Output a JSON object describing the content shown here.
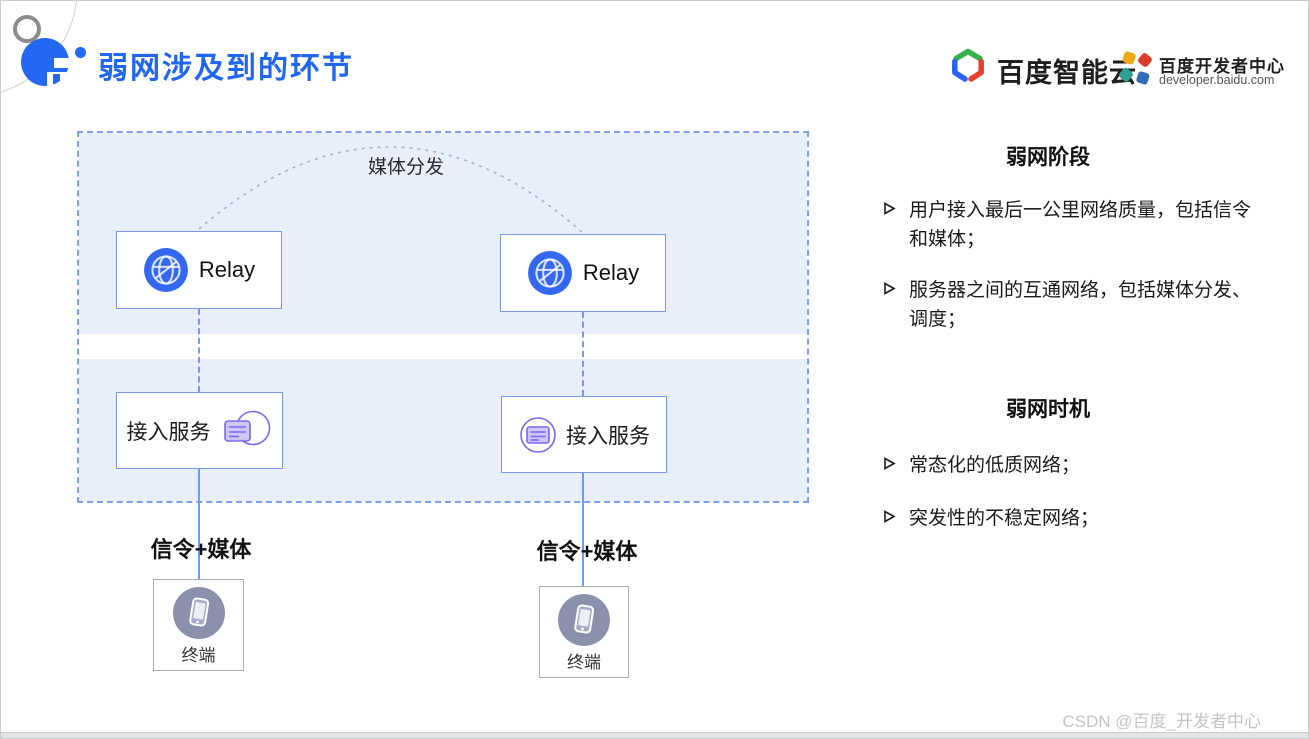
{
  "header": {
    "title": "弱网涉及到的环节",
    "brand_cloud": "百度智能云",
    "brand_dev_name": "百度开发者中心",
    "brand_dev_url": "developer.baidu.com"
  },
  "diagram": {
    "arc_label": "媒体分发",
    "relay_left": "Relay",
    "relay_right": "Relay",
    "access_left": "接入服务",
    "access_right": "接入服务",
    "link_left": "信令+媒体",
    "link_right": "信令+媒体",
    "terminal_left": "终端",
    "terminal_right": "终端"
  },
  "panel": {
    "section1": {
      "title": "弱网阶段",
      "bullets": [
        "用户接入最后一公里网络质量，包括信令和媒体；",
        "服务器之间的互通网络，包括媒体分发、调度；"
      ]
    },
    "section2": {
      "title": "弱网时机",
      "bullets": [
        "常态化的低质网络；",
        "突发性的不稳定网络；"
      ]
    }
  },
  "watermark": "CSDN @百度_开发者中心",
  "icons": {
    "relay": "globe-network-icon",
    "access": "server-card-icon",
    "terminal": "mobile-phone-icon",
    "brand_cloud": "baidu-cloud-hexagon-icon",
    "brand_dev": "pinwheel-icon",
    "bullet": "arrowhead-marker-icon"
  },
  "colors": {
    "title_blue": "#2166EE",
    "diagram_fill": "#E9EEFB",
    "diagram_border": "#7D9EF5",
    "box_border": "#7B97E8",
    "relay_icon_blue": "#3568F0",
    "access_icon_purple": "#7B68F0",
    "terminal_icon_gray": "#8B90AC",
    "watermark_gray": "#C4C4C4"
  }
}
